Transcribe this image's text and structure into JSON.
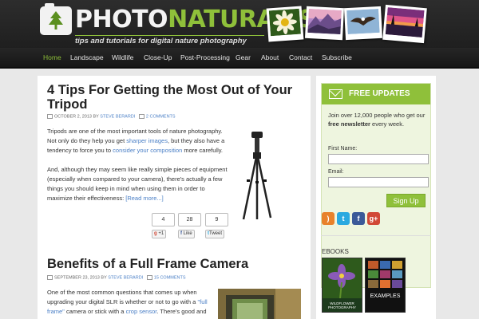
{
  "site": {
    "logo_part1": "PHOTO",
    "logo_part2": "NATURALIST",
    "tagline": "tips and tutorials for digital nature photography"
  },
  "header_photos": [
    "flower",
    "mountains",
    "eagle",
    "sunset"
  ],
  "nav": [
    "Home",
    "Landscape",
    "Wildlife",
    "Close-Up",
    "Post-Processing",
    "Gear",
    "About",
    "Contact",
    "Subscribe"
  ],
  "post1": {
    "title_line1": "4 Tips For Getting the Most Out of Your",
    "title_line2": "Tripod",
    "date": "OCTOBER 2, 2013",
    "by": "BY",
    "author": "STEVE BERARDI",
    "comments": "2 COMMENTS",
    "p1_a": "Tripods are one of the most important tools of nature photography.",
    "p1_b": "Not only do they help you get",
    "p1_link1": "sharper images",
    "p1_c": ", but they also have a",
    "p1_d": "tendency to force you to",
    "p1_link2": "consider your composition",
    "p1_e": "more carefully.",
    "p2_a": "And, although they may seem like really simple pieces of equipment",
    "p2_b": "(especially when compared to your camera), there's actually a few",
    "p2_c": "things you should keep in mind when using them in order to",
    "p2_d": "maximize their effectiveness:",
    "read_more": "[Read more...]",
    "share": {
      "gplus_count": "4",
      "fb_count": "28",
      "tw_count": "9",
      "gplus_label": "+1",
      "fb_label": "Like",
      "tw_label": "Tweet"
    }
  },
  "post2": {
    "title": "Benefits of a Full Frame Camera",
    "date": "SEPTEMBER 23, 2013",
    "by": "BY",
    "author": "STEVE BERARDI",
    "comments": "15 COMMENTS",
    "l1": "One of the most common questions that comes up when",
    "l2_a": "upgrading your digital SLR is whether or not to go with a",
    "l2_link": "\"full",
    "l3_link": "frame\"",
    "l3_b": "camera or stick with a",
    "l3_link2": "crop sensor",
    "l3_c": ". There's good and"
  },
  "sidebar": {
    "free_updates_title": "FREE UPDATES",
    "join_text_a": "Join over 12,000 people who get our",
    "join_bold": "free newsletter",
    "join_text_b": "every week.",
    "first_name_label": "First Name:",
    "email_label": "Email:",
    "signup_button": "Sign Up",
    "social_icons": [
      "rss-icon",
      "twitter-icon",
      "facebook-icon",
      "googleplus-icon"
    ],
    "ebooks_title": "EBOOKS",
    "ebook1_label": "WILDFLOWER PHOTOGRAPHY",
    "ebook2_label": "EXAMPLES"
  },
  "colors": {
    "accent": "#8fc03a",
    "link": "#4a7fc6",
    "header_bg": "#262626"
  }
}
